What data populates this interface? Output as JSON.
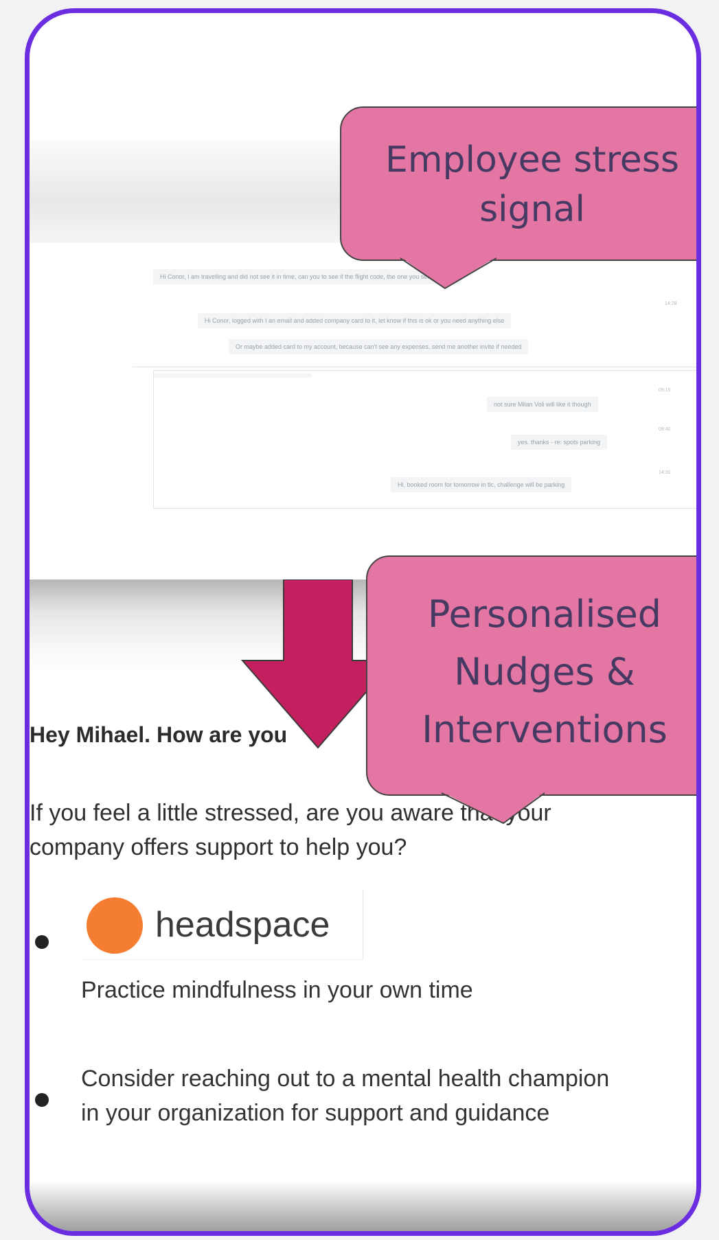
{
  "callouts": {
    "top": {
      "line1": "Employee stress",
      "line2": "signal"
    },
    "bottom": {
      "line1": "Personalised",
      "line2": "Nudges &",
      "line3": "Interventions"
    }
  },
  "chat": {
    "messages_group1": [
      "Hi Conor, I am travelling and did not see it in time, can you to see if the flight code, the one you sent expired",
      "Hi Conor, logged with I an email and added company card to it, let know if this is ok or you need anything else",
      "Or maybe added card to my account, because can't see any expenses, send me another invite if needed"
    ],
    "group1_timestamp": "14:28",
    "messages_group2": [
      "not sure Milan Voli will like it though",
      "yes. thanks - re: spots parking",
      "Hi, booked room for tomorrow in tlc, challenge will be parking"
    ],
    "group2_timestamps": [
      "09:15",
      "09:40",
      "14:30"
    ]
  },
  "nudge": {
    "greeting": "Hey Mihael. How are you",
    "question": "If you feel a little stressed, are you aware that your company offers support to help you?",
    "items": [
      {
        "brand": "headspace",
        "text": "Practice mindfulness in your own time"
      },
      {
        "text": "Consider reaching out to a mental health champion in your organization for support and guidance"
      }
    ]
  },
  "colors": {
    "frame_border": "#6a2de0",
    "callout_fill": "#e476a4",
    "callout_text": "#463a63",
    "arrow_fill": "#c41f5e",
    "headspace_orange": "#f47d31"
  }
}
